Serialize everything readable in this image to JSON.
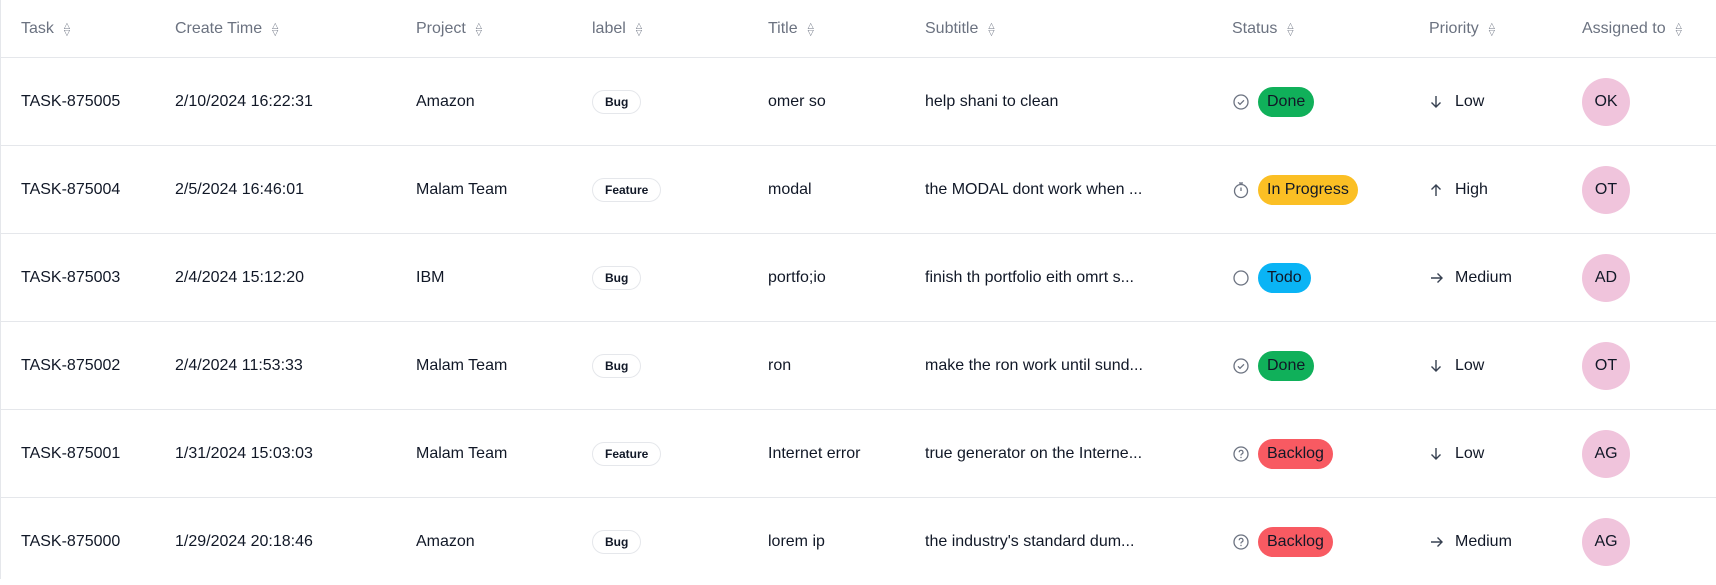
{
  "columns": [
    "Task",
    "Create Time",
    "Project",
    "label",
    "Title",
    "Subtitle",
    "Status",
    "Priority",
    "Assigned to"
  ],
  "status_colors": {
    "Done": "#10b05a",
    "In Progress": "#fbbf24",
    "Todo": "#0ab4f5",
    "Backlog": "#f85a62"
  },
  "rows": [
    {
      "task": "TASK-875005",
      "create_time": "2/10/2024 16:22:31",
      "project": "Amazon",
      "label": "Bug",
      "title": "omer so",
      "subtitle": "help shani to clean",
      "status": "Done",
      "status_icon": "check-circle-icon",
      "priority": "Low",
      "priority_icon": "arrow-down-icon",
      "assignee": "OK"
    },
    {
      "task": "TASK-875004",
      "create_time": "2/5/2024 16:46:01",
      "project": "Malam Team",
      "label": "Feature",
      "title": "modal",
      "subtitle": "the MODAL dont work when ...",
      "status": "In Progress",
      "status_icon": "stopwatch-icon",
      "priority": "High",
      "priority_icon": "arrow-up-icon",
      "assignee": "OT"
    },
    {
      "task": "TASK-875003",
      "create_time": "2/4/2024 15:12:20",
      "project": "IBM",
      "label": "Bug",
      "title": "portfo;io",
      "subtitle": "finish th portfolio eith omrt s...",
      "status": "Todo",
      "status_icon": "circle-icon",
      "priority": "Medium",
      "priority_icon": "arrow-right-icon",
      "assignee": "AD"
    },
    {
      "task": "TASK-875002",
      "create_time": "2/4/2024 11:53:33",
      "project": "Malam Team",
      "label": "Bug",
      "title": "ron",
      "subtitle": "make the ron work until sund...",
      "status": "Done",
      "status_icon": "check-circle-icon",
      "priority": "Low",
      "priority_icon": "arrow-down-icon",
      "assignee": "OT"
    },
    {
      "task": "TASK-875001",
      "create_time": "1/31/2024 15:03:03",
      "project": "Malam Team",
      "label": "Feature",
      "title": "Internet error",
      "subtitle": "true generator on the Interne...",
      "status": "Backlog",
      "status_icon": "help-circle-icon",
      "priority": "Low",
      "priority_icon": "arrow-down-icon",
      "assignee": "AG"
    },
    {
      "task": "TASK-875000",
      "create_time": "1/29/2024 20:18:46",
      "project": "Amazon",
      "label": "Bug",
      "title": "lorem ip",
      "subtitle": "the industry's standard dum...",
      "status": "Backlog",
      "status_icon": "help-circle-icon",
      "priority": "Medium",
      "priority_icon": "arrow-right-icon",
      "assignee": "AG"
    }
  ]
}
